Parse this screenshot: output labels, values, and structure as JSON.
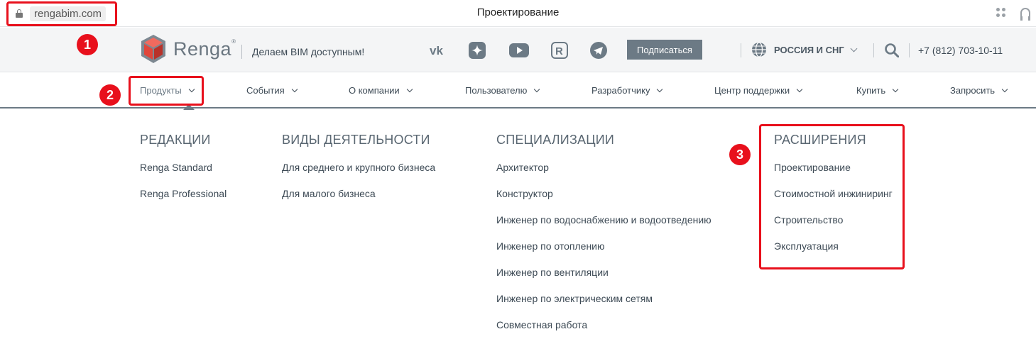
{
  "browser": {
    "url": "rengabim.com",
    "page_title": "Проектирование"
  },
  "header": {
    "logo_text": "Renga",
    "logo_mark": "®",
    "slogan": "Делаем BIM доступным!",
    "social_icons": [
      "vk-icon",
      "dzen-icon",
      "youtube-icon",
      "rutube-icon",
      "telegram-icon"
    ],
    "subscribe_label": "Подписаться",
    "region_label": "РОССИЯ И СНГ",
    "phone": "+7 (812) 703-10-11"
  },
  "nav": {
    "items": [
      {
        "label": "Продукты"
      },
      {
        "label": "События"
      },
      {
        "label": "О компании"
      },
      {
        "label": "Пользователю"
      },
      {
        "label": "Разработчику"
      },
      {
        "label": "Центр поддержки"
      },
      {
        "label": "Купить"
      },
      {
        "label": "Запросить"
      }
    ]
  },
  "dropdown": {
    "columns": [
      {
        "title": "РЕДАКЦИИ",
        "links": [
          "Renga Standard",
          "Renga Professional"
        ]
      },
      {
        "title": "ВИДЫ ДЕЯТЕЛЬНОСТИ",
        "links": [
          "Для среднего и крупного бизнеса",
          "Для малого бизнеса"
        ]
      },
      {
        "title": "СПЕЦИАЛИЗАЦИИ",
        "links": [
          "Архитектор",
          "Конструктор",
          "Инженер по водоснабжению и водоотведению",
          "Инженер по отоплению",
          "Инженер по вентиляции",
          "Инженер по электрическим сетям",
          "Совместная работа"
        ]
      },
      {
        "title": "РАСШИРЕНИЯ",
        "links": [
          "Проектирование",
          "Стоимостной инжиниринг",
          "Строительство",
          "Эксплуатация"
        ]
      }
    ]
  },
  "annotations": [
    "1",
    "2",
    "3"
  ],
  "colors": {
    "accent": "#6c7a85",
    "annotation_red": "#e8101c",
    "header_bg": "#f4f5f6"
  }
}
